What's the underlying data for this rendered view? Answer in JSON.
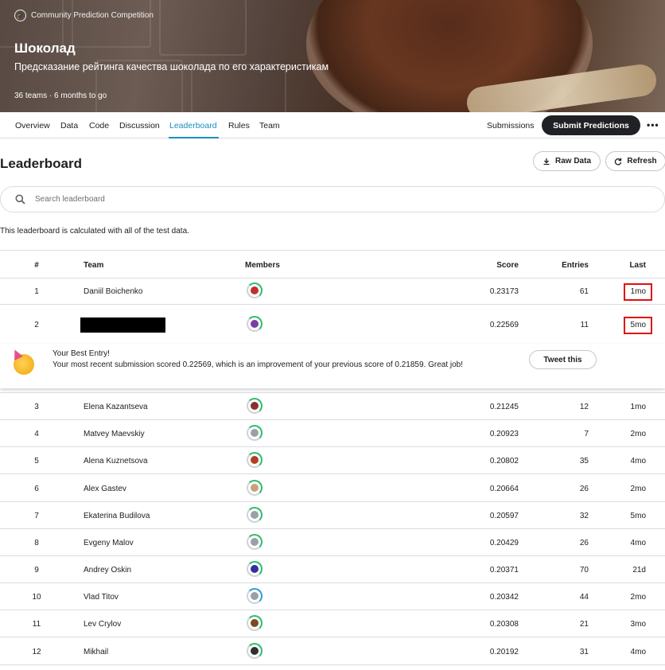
{
  "header": {
    "competition_type": "Community Prediction Competition",
    "title": "Шоколад",
    "subtitle": "Предсказание рейтинга качества шоколада по его характеристикам",
    "meta": "36 teams · 6 months to go"
  },
  "tabs": [
    {
      "label": "Overview"
    },
    {
      "label": "Data"
    },
    {
      "label": "Code"
    },
    {
      "label": "Discussion"
    },
    {
      "label": "Leaderboard",
      "active": true
    },
    {
      "label": "Rules"
    },
    {
      "label": "Team"
    }
  ],
  "actions": {
    "submissions": "Submissions",
    "submit": "Submit Predictions",
    "more": "•••"
  },
  "leaderboard": {
    "title": "Leaderboard",
    "raw_data": "Raw Data",
    "refresh": "Refresh",
    "search_placeholder": "Search leaderboard",
    "note": "This leaderboard is calculated with all of the test data.",
    "columns": {
      "rank": "#",
      "team": "Team",
      "members": "Members",
      "score": "Score",
      "entries": "Entries",
      "last": "Last"
    },
    "rows": [
      {
        "rank": "1",
        "team": "Daniil Boichenko",
        "score": "0.23173",
        "entries": "61",
        "last": "1mo"
      },
      {
        "rank": "2",
        "team": "",
        "score": "0.22569",
        "entries": "11",
        "last": "5mo"
      },
      {
        "rank": "3",
        "team": "Elena Kazantseva",
        "score": "0.21245",
        "entries": "12",
        "last": "1mo"
      },
      {
        "rank": "4",
        "team": "Matvey Maevskiy",
        "score": "0.20923",
        "entries": "7",
        "last": "2mo"
      },
      {
        "rank": "5",
        "team": "Alena Kuznetsova",
        "score": "0.20802",
        "entries": "35",
        "last": "4mo"
      },
      {
        "rank": "6",
        "team": "Alex Gastev",
        "score": "0.20664",
        "entries": "26",
        "last": "2mo"
      },
      {
        "rank": "7",
        "team": "Ekaterina Budilova",
        "score": "0.20597",
        "entries": "32",
        "last": "5mo"
      },
      {
        "rank": "8",
        "team": "Evgeny Malov",
        "score": "0.20429",
        "entries": "26",
        "last": "4mo"
      },
      {
        "rank": "9",
        "team": "Andrey Oskin",
        "score": "0.20371",
        "entries": "70",
        "last": "21d"
      },
      {
        "rank": "10",
        "team": "Vlad Titov",
        "score": "0.20342",
        "entries": "44",
        "last": "2mo"
      },
      {
        "rank": "11",
        "team": "Lev Crylov",
        "score": "0.20308",
        "entries": "21",
        "last": "3mo"
      },
      {
        "rank": "12",
        "team": "Mikhail",
        "score": "0.20192",
        "entries": "31",
        "last": "4mo"
      }
    ],
    "best_entry": {
      "title": "Your Best Entry!",
      "text": "Your most recent submission scored 0.22569, which is an improvement of your previous score of 0.21859. Great job!",
      "tweet": "Tweet this"
    }
  },
  "colors": {
    "accent": "#1a8fbd",
    "dark_button": "#202124",
    "highlight": "#e01010",
    "progress": "#2dbd6e"
  }
}
